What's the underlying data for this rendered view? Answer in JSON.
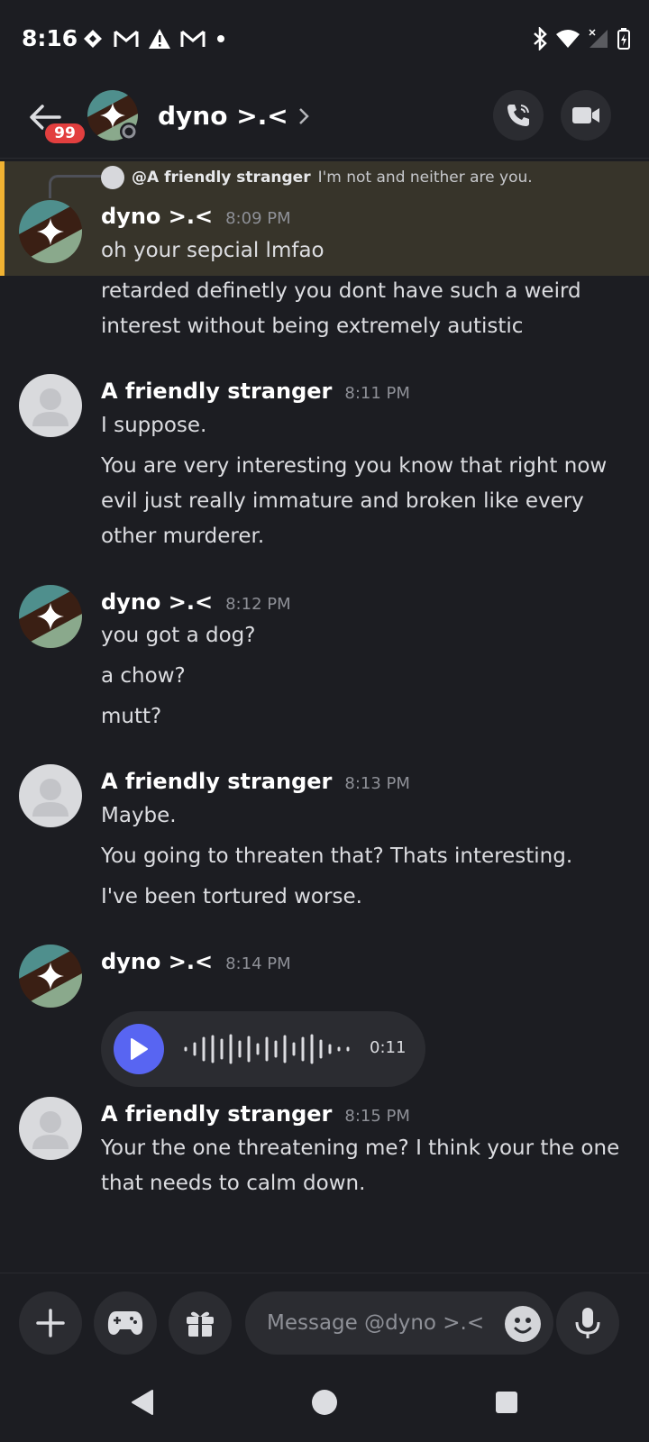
{
  "status_bar": {
    "time": "8:16",
    "left_icons": [
      "diamond-icon",
      "gmail-icon",
      "warning-icon",
      "gmail-icon",
      "dot-icon"
    ],
    "right_icons": [
      "bluetooth-icon",
      "wifi-icon",
      "signal-icon",
      "battery-icon"
    ]
  },
  "header": {
    "back_badge": "99",
    "title": "dyno >.<",
    "call_icon": "phone-call-icon",
    "video_icon": "video-camera-icon"
  },
  "reply": {
    "name": "@A friendly stranger",
    "text": "I'm not and neither are you."
  },
  "messages": [
    {
      "author": "dyno >.<",
      "time": "8:09 PM",
      "lines": [
        "oh your sepcial lmfao",
        "retarded definetly you dont have such a weird interest without being extremely autistic"
      ]
    },
    {
      "author": "A friendly stranger",
      "time": "8:11 PM",
      "lines": [
        "I suppose.",
        "You are very interesting you know that right now evil just really immature and broken like every other murderer."
      ]
    },
    {
      "author": "dyno >.<",
      "time": "8:12 PM",
      "lines": [
        "you got a dog?",
        "a chow?",
        "mutt?"
      ]
    },
    {
      "author": "A friendly stranger",
      "time": "8:13 PM",
      "lines": [
        "Maybe.",
        "You going to threaten that? Thats interesting.",
        "I've been tortured worse."
      ]
    },
    {
      "author": "dyno >.<",
      "time": "8:14 PM",
      "voice_duration": "0:11"
    },
    {
      "author": "A friendly stranger",
      "time": "8:15 PM",
      "lines": [
        "Your the one threatening me? I think your the one that needs to calm down."
      ]
    }
  ],
  "composer": {
    "placeholder": "Message @dyno >.<",
    "buttons": [
      "plus-icon",
      "gamepad-icon",
      "gift-icon",
      "emoji-icon",
      "microphone-icon"
    ]
  },
  "colors": {
    "background": "#1c1d22",
    "highlight": "#37342a",
    "highlight_bar": "#f0b232",
    "accent": "#5865f2",
    "badge": "#e23f3f"
  }
}
